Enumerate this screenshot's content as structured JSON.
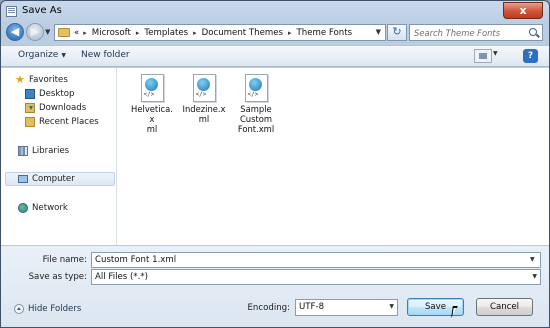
{
  "window": {
    "title": "Save As",
    "close_label": "x"
  },
  "address_bar": {
    "prefix": "«",
    "breadcrumbs": [
      "Microsoft",
      "Templates",
      "Document Themes",
      "Theme Fonts"
    ],
    "separator": "▸",
    "refresh_icon": "refresh-icon",
    "search_placeholder": "Search Theme Fonts"
  },
  "toolbar": {
    "organize_label": "Organize",
    "new_folder_label": "New folder",
    "help_label": "?"
  },
  "sidebar": {
    "favorites_label": "Favorites",
    "favorites": [
      {
        "label": "Desktop",
        "icon": "desktop-icon"
      },
      {
        "label": "Downloads",
        "icon": "downloads-icon"
      },
      {
        "label": "Recent Places",
        "icon": "recent-places-icon"
      }
    ],
    "libraries_label": "Libraries",
    "computer_label": "Computer",
    "network_label": "Network"
  },
  "files": [
    {
      "name": "Helvetica.xml",
      "display": "Helvetica.x\nml",
      "icon": "xml-file-icon"
    },
    {
      "name": "Indezine.xml",
      "display": "Indezine.x\nml",
      "icon": "xml-file-icon"
    },
    {
      "name": "Sample Custom Font.xml",
      "display": "Sample\nCustom\nFont.xml",
      "icon": "xml-file-icon"
    }
  ],
  "form": {
    "file_name_label": "File name:",
    "file_name_value": "Custom Font 1.xml",
    "save_as_type_label": "Save as type:",
    "save_as_type_value": "All Files  (*.*)",
    "encoding_label": "Encoding:",
    "encoding_value": "UTF-8",
    "hide_folders_label": "Hide Folders",
    "save_label": "Save",
    "cancel_label": "Cancel"
  }
}
